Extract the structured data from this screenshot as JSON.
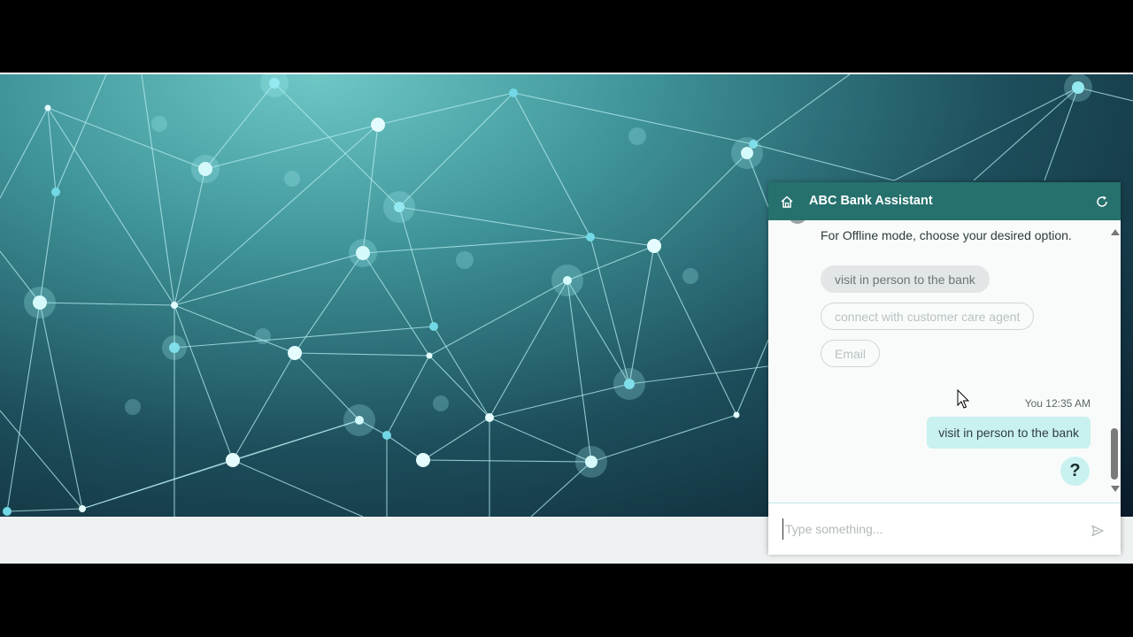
{
  "chat": {
    "title": "ABC Bank Assistant",
    "bot_message": "For Offline mode, choose your desired option.",
    "options": [
      {
        "label": "visit in person to the bank",
        "state": "selected"
      },
      {
        "label": "connect with customer care agent",
        "state": "disabled"
      },
      {
        "label": "Email",
        "state": "disabled"
      }
    ],
    "user_meta": "You 12:35 AM",
    "user_message": "visit in person to the bank",
    "help_label": "?",
    "input": {
      "value": "",
      "placeholder": "Type something..."
    },
    "icons": {
      "home": "home-icon",
      "refresh": "refresh-icon",
      "send": "send-icon",
      "help": "help-icon"
    },
    "colors": {
      "header": "#26716d",
      "bubble": "#c9f1ef"
    }
  }
}
